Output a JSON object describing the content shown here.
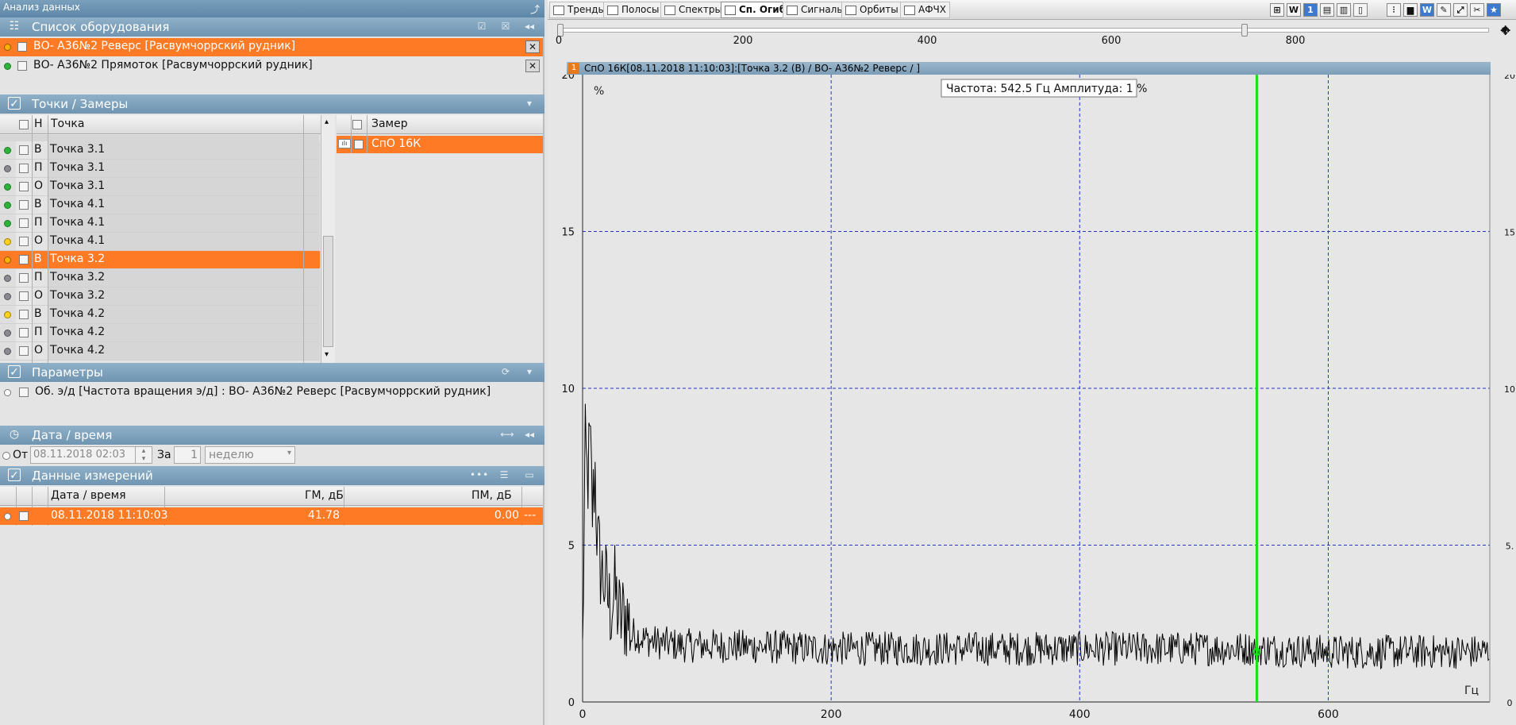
{
  "window": {
    "title": "Анализ данных"
  },
  "equipment": {
    "header": "Список оборудования",
    "items": [
      {
        "label": "ВО- А36№2 Реверс [Расвумчоррский рудник]",
        "status": "orange",
        "selected": true
      },
      {
        "label": "ВО- А36№2 Прямоток [Расвумчоррский рудник]",
        "status": "green",
        "selected": false
      }
    ]
  },
  "points": {
    "header": "Точки / Замеры",
    "col_h": "Н",
    "col_point": "Точка",
    "rows": [
      {
        "h": "В",
        "name": "Точка 3.1",
        "status": "green",
        "selected": false
      },
      {
        "h": "П",
        "name": "Точка 3.1",
        "status": "grey",
        "selected": false
      },
      {
        "h": "О",
        "name": "Точка 3.1",
        "status": "green",
        "selected": false
      },
      {
        "h": "В",
        "name": "Точка 4.1",
        "status": "green",
        "selected": false
      },
      {
        "h": "П",
        "name": "Точка 4.1",
        "status": "green",
        "selected": false
      },
      {
        "h": "О",
        "name": "Точка 4.1",
        "status": "yellow",
        "selected": false
      },
      {
        "h": "В",
        "name": "Точка 3.2",
        "status": "orange",
        "selected": true
      },
      {
        "h": "П",
        "name": "Точка 3.2",
        "status": "grey",
        "selected": false
      },
      {
        "h": "О",
        "name": "Точка 3.2",
        "status": "grey",
        "selected": false
      },
      {
        "h": "В",
        "name": "Точка 4.2",
        "status": "yellow",
        "selected": false
      },
      {
        "h": "П",
        "name": "Точка 4.2",
        "status": "grey",
        "selected": false
      },
      {
        "h": "О",
        "name": "Точка 4.2",
        "status": "grey",
        "selected": false
      }
    ],
    "col_measure": "Замер",
    "measures": [
      {
        "label": "СпО 16К",
        "selected": true
      }
    ]
  },
  "params": {
    "header": "Параметры",
    "items": [
      {
        "label": "Об. э/д [Частота вращения э/д] : ВО- А36№2 Реверс [Расвумчоррский рудник]"
      }
    ]
  },
  "datetime": {
    "header": "Дата / время",
    "from_label": "От",
    "from_value": "08.11.2018 02:03",
    "for_label": "За",
    "count_value": "1",
    "period_value": "неделю"
  },
  "measurements": {
    "header": "Данные измерений",
    "columns": [
      "Дата / время",
      "ГМ, дБ",
      "ПМ, дБ"
    ],
    "rows": [
      {
        "datetime": "08.11.2018 11:10:03",
        "gm": "41.78",
        "pm": "0.00",
        "extra": "---"
      }
    ]
  },
  "tabs": [
    {
      "label": "Тренды",
      "active": false
    },
    {
      "label": "Полосы",
      "active": false
    },
    {
      "label": "Спектры",
      "active": false
    },
    {
      "label": "Сп. Огиб.",
      "active": true
    },
    {
      "label": "Сигналы",
      "active": false
    },
    {
      "label": "Орбиты",
      "active": false
    },
    {
      "label": "АФЧХ",
      "active": false
    }
  ],
  "toolbar_buttons": [
    "W",
    "1",
    "W"
  ],
  "ruler": {
    "labels": [
      "0",
      "200",
      "400",
      "600",
      "800"
    ]
  },
  "chart": {
    "series_num": "1",
    "header": "СпО 16К[08.11.2018 11:10:03]:[Точка 3.2 (В) / ВО- А36№2 Реверс / ]",
    "unit_y": "%",
    "unit_x": "Гц",
    "cursor_text": "Частота: 542.5 Гц   Амплитуда: 1 %",
    "colors": {
      "cursor": "#19e019",
      "grid": "#2233cc",
      "trace": "#000000",
      "accent": "#ff7a24"
    }
  },
  "chart_data": {
    "type": "line",
    "title": "СпО 16К[08.11.2018 11:10:03]:[Точка 3.2 (В) / ВО- А36№2 Реверс / ]",
    "xlabel": "Гц",
    "ylabel": "%",
    "xlim": [
      0,
      730
    ],
    "ylim": [
      0,
      20
    ],
    "x_ticks": [
      "0",
      "200",
      "400",
      "600"
    ],
    "y_ticks": [
      "0",
      "5",
      "10",
      "15",
      "20"
    ],
    "right_y_ticks": [
      "0",
      "5.",
      "10",
      "15",
      "20"
    ],
    "grid": true,
    "cursor": {
      "x": 542.5,
      "y": 1
    },
    "series": [
      {
        "values_x": [
          0,
          2,
          4,
          6,
          8,
          10,
          12,
          15,
          18,
          22,
          26,
          30,
          35,
          40,
          50,
          60,
          80,
          100,
          150,
          200,
          300,
          400,
          500,
          542.5,
          600,
          700,
          730
        ],
        "values_y": [
          1.5,
          8.0,
          7.0,
          8.3,
          6.0,
          7.5,
          5.0,
          4.2,
          3.8,
          3.0,
          3.5,
          2.6,
          2.8,
          2.2,
          2.0,
          1.9,
          1.8,
          1.8,
          1.75,
          1.7,
          1.7,
          1.7,
          1.7,
          1.7,
          1.6,
          1.6,
          1.6
        ]
      }
    ]
  }
}
